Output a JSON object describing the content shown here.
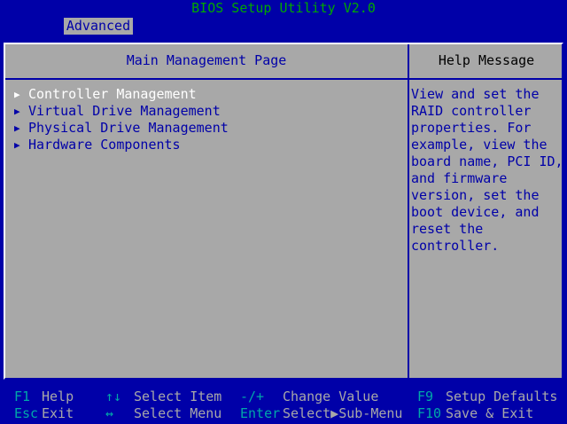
{
  "window": {
    "title": "BIOS Setup Utility V2.0"
  },
  "tabs": [
    {
      "label": "Advanced",
      "active": true
    }
  ],
  "main": {
    "heading": "Main Management Page",
    "items": [
      {
        "label": "Controller Management",
        "selected": true
      },
      {
        "label": "Virtual Drive Management",
        "selected": false
      },
      {
        "label": "Physical Drive Management",
        "selected": false
      },
      {
        "label": "Hardware Components",
        "selected": false
      }
    ]
  },
  "help": {
    "heading": "Help Message",
    "lines": [
      "View and set the",
      "RAID controller",
      "properties. For",
      "example, view the",
      "board name, PCI ID,",
      "and firmware",
      "version, set the",
      "boot device, and",
      "reset the",
      "controller."
    ]
  },
  "footer": {
    "row1": [
      {
        "key": "F1",
        "desc": "Help"
      },
      {
        "key": "↑↓",
        "desc": "Select Item"
      },
      {
        "key": "-/+",
        "desc": "Change Value"
      },
      {
        "key": "F9",
        "desc": "Setup Defaults"
      }
    ],
    "row2": [
      {
        "key": "Esc",
        "desc": "Exit"
      },
      {
        "key": "↔",
        "desc": "Select Menu"
      },
      {
        "key": "Enter",
        "desc": "Select▶Sub-Menu"
      },
      {
        "key": "F10",
        "desc": "Save & Exit"
      }
    ]
  },
  "colors": {
    "background": "#0000a8",
    "panel": "#a8a8a8",
    "title": "#00a800",
    "selected_text": "#ffffff",
    "footer_key": "#00a8a8"
  }
}
